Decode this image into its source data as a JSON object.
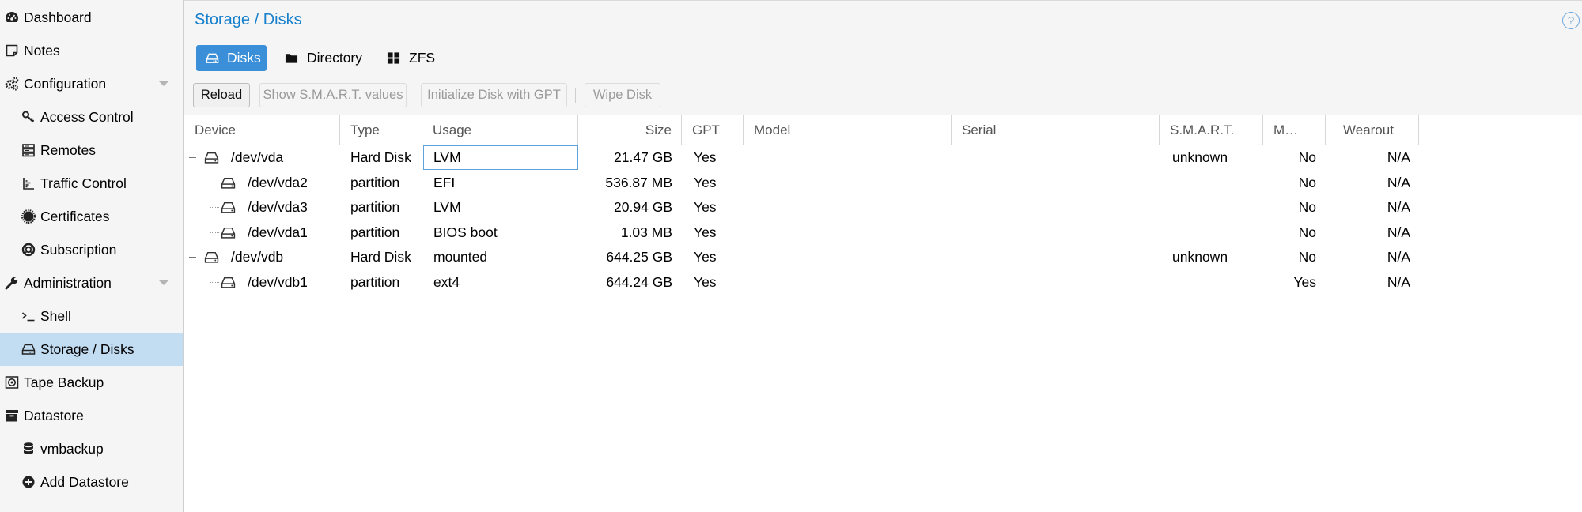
{
  "sidebar": {
    "items": [
      {
        "label": "Dashboard",
        "icon": "dashboard-icon",
        "level": 0
      },
      {
        "label": "Notes",
        "icon": "notes-icon",
        "level": 0
      },
      {
        "label": "Configuration",
        "icon": "gears-icon",
        "level": 0,
        "expandable": true
      },
      {
        "label": "Access Control",
        "icon": "key-icon",
        "level": 1
      },
      {
        "label": "Remotes",
        "icon": "server-icon",
        "level": 1
      },
      {
        "label": "Traffic Control",
        "icon": "traffic-chart-icon",
        "level": 1
      },
      {
        "label": "Certificates",
        "icon": "certificate-icon",
        "level": 1
      },
      {
        "label": "Subscription",
        "icon": "support-icon",
        "level": 1
      },
      {
        "label": "Administration",
        "icon": "wrench-icon",
        "level": 0,
        "expandable": true
      },
      {
        "label": "Shell",
        "icon": "terminal-icon",
        "level": 1
      },
      {
        "label": "Storage / Disks",
        "icon": "hdd-icon",
        "level": 1,
        "selected": true
      },
      {
        "label": "Tape Backup",
        "icon": "tape-icon",
        "level": 0
      },
      {
        "label": "Datastore",
        "icon": "archive-icon",
        "level": 0
      },
      {
        "label": "vmbackup",
        "icon": "database-icon",
        "level": 1
      },
      {
        "label": "Add Datastore",
        "icon": "plus-circle-icon",
        "level": 1
      }
    ]
  },
  "header": {
    "title": "Storage / Disks",
    "help_icon": "?",
    "tabs": [
      {
        "label": "Disks",
        "icon": "hdd-icon",
        "active": true
      },
      {
        "label": "Directory",
        "icon": "folder-icon"
      },
      {
        "label": "ZFS",
        "icon": "th-large-icon"
      }
    ]
  },
  "toolbar": {
    "reload": "Reload",
    "smart": "Show S.M.A.R.T. values",
    "init_gpt": "Initialize Disk with GPT",
    "wipe": "Wipe Disk"
  },
  "grid": {
    "columns": {
      "device": "Device",
      "type": "Type",
      "usage": "Usage",
      "size": "Size",
      "gpt": "GPT",
      "model": "Model",
      "serial": "Serial",
      "smart": "S.M.A.R.T.",
      "mounted": "M…",
      "wearout": "Wearout"
    },
    "rows": [
      {
        "device": "/dev/vda",
        "type": "Hard Disk",
        "usage": "LVM",
        "size": "21.47 GB",
        "gpt": "Yes",
        "model": "",
        "serial": "",
        "smart": "unknown",
        "mounted": "No",
        "wearout": "N/A",
        "depth": 0,
        "expanded": true
      },
      {
        "device": "/dev/vda2",
        "type": "partition",
        "usage": "EFI",
        "size": "536.87 MB",
        "gpt": "Yes",
        "model": "",
        "serial": "",
        "smart": "",
        "mounted": "No",
        "wearout": "N/A",
        "depth": 1
      },
      {
        "device": "/dev/vda3",
        "type": "partition",
        "usage": "LVM",
        "size": "20.94 GB",
        "gpt": "Yes",
        "model": "",
        "serial": "",
        "smart": "",
        "mounted": "No",
        "wearout": "N/A",
        "depth": 1
      },
      {
        "device": "/dev/vda1",
        "type": "partition",
        "usage": "BIOS boot",
        "size": "1.03 MB",
        "gpt": "Yes",
        "model": "",
        "serial": "",
        "smart": "",
        "mounted": "No",
        "wearout": "N/A",
        "depth": 1
      },
      {
        "device": "/dev/vdb",
        "type": "Hard Disk",
        "usage": "mounted",
        "size": "644.25 GB",
        "gpt": "Yes",
        "model": "",
        "serial": "",
        "smart": "unknown",
        "mounted": "No",
        "wearout": "N/A",
        "depth": 0,
        "expanded": true
      },
      {
        "device": "/dev/vdb1",
        "type": "partition",
        "usage": "ext4",
        "size": "644.24 GB",
        "gpt": "Yes",
        "model": "",
        "serial": "",
        "smart": "",
        "mounted": "Yes",
        "wearout": "N/A",
        "depth": 1
      }
    ]
  },
  "colors": {
    "accent": "#3a8fd8",
    "title": "#157fcc",
    "selected_nav": "#c2dcf2"
  }
}
